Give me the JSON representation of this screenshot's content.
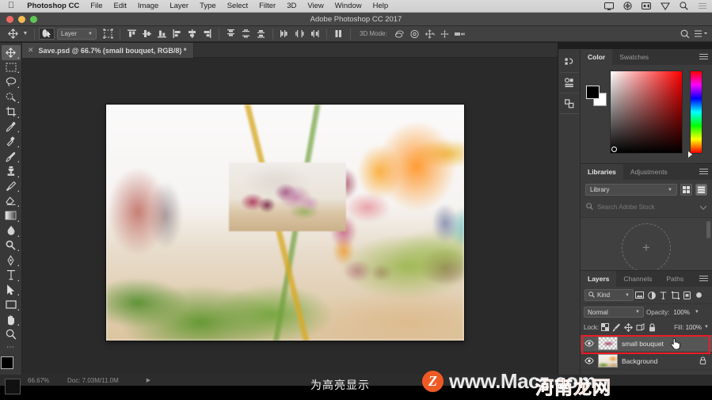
{
  "menubar": {
    "apple_icon": "apple-icon",
    "app_name": "Photoshop CC",
    "items": [
      "File",
      "Edit",
      "Image",
      "Layer",
      "Type",
      "Select",
      "Filter",
      "3D",
      "View",
      "Window",
      "Help"
    ],
    "status_icons": [
      "display-icon",
      "spotlight-wheel-icon",
      "screen-record-icon",
      "shield-icon",
      "search-icon",
      "control-center-icon"
    ]
  },
  "titlebar": {
    "title": "Adobe Photoshop CC 2017",
    "traffic_lights": [
      "close-red",
      "minimize-yellow",
      "zoom-green"
    ]
  },
  "options_bar": {
    "tool_icon": "move-tool-icon",
    "tool_caret": "chevron-down-icon",
    "auto_select_label": "Layer",
    "auto_select_icon": "auto-select-icon",
    "transform_controls_icon": "show-transform-controls-icon",
    "align_icons": [
      "align-top-edges-icon",
      "align-vertical-centers-icon",
      "align-bottom-edges-icon",
      "align-left-edges-icon",
      "align-horizontal-centers-icon",
      "align-right-edges-icon"
    ],
    "distribute_icons": [
      "distribute-top-edges-icon",
      "distribute-vertical-centers-icon",
      "distribute-bottom-edges-icon",
      "distribute-left-edges-icon",
      "distribute-horizontal-centers-icon",
      "distribute-right-edges-icon"
    ],
    "more_icon": "align-more-icon",
    "mode_3d_label": "3D Mode:",
    "mode_3d_icons": [
      "rotate-3d-icon",
      "roll-3d-icon",
      "drag-3d-icon",
      "slide-3d-icon",
      "scale-3d-icon"
    ],
    "search_icon": "search-icon",
    "workspace_icon": "workspace-switcher-icon"
  },
  "document_tab": {
    "close_icon": "close-icon",
    "title": "Save.psd @ 66.7% (small bouquet, RGB/8) *"
  },
  "toolbar": {
    "tools": [
      {
        "name": "move-tool",
        "icon": "move-tool-icon",
        "selected": true,
        "has_flyout": true
      },
      {
        "name": "rectangular-marquee-tool",
        "icon": "marquee-icon",
        "selected": false,
        "has_flyout": true
      },
      {
        "name": "lasso-tool",
        "icon": "lasso-icon",
        "selected": false,
        "has_flyout": true
      },
      {
        "name": "quick-selection-tool",
        "icon": "quick-selection-icon",
        "selected": false,
        "has_flyout": true
      },
      {
        "name": "crop-tool",
        "icon": "crop-icon",
        "selected": false,
        "has_flyout": true
      },
      {
        "name": "eyedropper-tool",
        "icon": "eyedropper-icon",
        "selected": false,
        "has_flyout": true
      },
      {
        "name": "spot-healing-brush-tool",
        "icon": "healing-brush-icon",
        "selected": false,
        "has_flyout": true
      },
      {
        "name": "brush-tool",
        "icon": "brush-icon",
        "selected": false,
        "has_flyout": true
      },
      {
        "name": "clone-stamp-tool",
        "icon": "clone-stamp-icon",
        "selected": false,
        "has_flyout": true
      },
      {
        "name": "history-brush-tool",
        "icon": "history-brush-icon",
        "selected": false,
        "has_flyout": true
      },
      {
        "name": "eraser-tool",
        "icon": "eraser-icon",
        "selected": false,
        "has_flyout": true
      },
      {
        "name": "gradient-tool",
        "icon": "gradient-icon",
        "selected": false,
        "has_flyout": true
      },
      {
        "name": "blur-tool",
        "icon": "blur-drop-icon",
        "selected": false,
        "has_flyout": true
      },
      {
        "name": "dodge-tool",
        "icon": "dodge-icon",
        "selected": false,
        "has_flyout": true
      },
      {
        "name": "pen-tool",
        "icon": "pen-icon",
        "selected": false,
        "has_flyout": true
      },
      {
        "name": "horizontal-type-tool",
        "icon": "type-icon",
        "selected": false,
        "has_flyout": true
      },
      {
        "name": "path-selection-tool",
        "icon": "path-selection-arrow-icon",
        "selected": false,
        "has_flyout": true
      },
      {
        "name": "rectangle-tool",
        "icon": "rectangle-shape-icon",
        "selected": false,
        "has_flyout": true
      },
      {
        "name": "hand-tool",
        "icon": "hand-icon",
        "selected": false,
        "has_flyout": true
      },
      {
        "name": "zoom-tool",
        "icon": "magnifier-icon",
        "selected": false,
        "has_flyout": false
      }
    ],
    "edit_toolbar_icon": "more-tools-icon",
    "foreground_color": "#000000",
    "background_color": "#ffffff"
  },
  "dock_strip": {
    "buttons": [
      "history-panel-icon",
      "properties-panel-icon",
      "layer-comps-panel-icon"
    ]
  },
  "color_panel": {
    "tabs": [
      {
        "label": "Color",
        "active": true
      },
      {
        "label": "Swatches",
        "active": false
      }
    ],
    "menu_icon": "panel-menu-icon",
    "foreground_color": "#000000",
    "background_color": "#ffffff",
    "spectrum_type": "hue-saturation-field",
    "hue_slider": "hue-strip"
  },
  "libraries_panel": {
    "tabs": [
      {
        "label": "Libraries",
        "active": true
      },
      {
        "label": "Adjustments",
        "active": false
      }
    ],
    "menu_icon": "panel-menu-icon",
    "library_select": "Library",
    "view_icons": [
      "grid-view-icon",
      "list-view-icon"
    ],
    "search_icon": "search-icon",
    "search_placeholder": "Search Adobe Stock",
    "search_caret": "chevron-down-icon",
    "empty_drop_icon": "plus-icon",
    "footer_icons": [
      "add-item-icon",
      "upload-icon",
      "sync-icon",
      "delete-icon"
    ]
  },
  "layers_panel": {
    "tabs": [
      {
        "label": "Layers",
        "active": true
      },
      {
        "label": "Channels",
        "active": false
      },
      {
        "label": "Paths",
        "active": false
      }
    ],
    "menu_icon": "panel-menu-icon",
    "filter_kind_label": "Kind",
    "filter_search_icon": "search-icon",
    "filter_icons": [
      "filter-pixel-icon",
      "filter-adjustment-icon",
      "filter-type-icon",
      "filter-shape-icon",
      "filter-smart-object-icon",
      "filter-toggle-icon"
    ],
    "blend_mode": "Normal",
    "opacity_label": "Opacity:",
    "opacity_value": "100%",
    "lock_label": "Lock:",
    "lock_icons": [
      "lock-transparent-pixels-icon",
      "lock-image-pixels-icon",
      "lock-position-icon",
      "lock-artboard-nesting-icon",
      "lock-all-icon"
    ],
    "fill_label": "Fill:",
    "fill_value": "100%",
    "layers": [
      {
        "name": "small bouquet",
        "visible": true,
        "visibility_icon": "eye-icon",
        "selected": true,
        "highlighted": true,
        "thumbnail": "transparent-bouquet-thumbnail",
        "locked": false
      },
      {
        "name": "Background",
        "visible": true,
        "visibility_icon": "eye-icon",
        "selected": false,
        "highlighted": false,
        "thumbnail": "flower-photo-thumbnail",
        "locked": true,
        "lock_icon": "lock-icon"
      }
    ],
    "cursor_icon": "pointing-hand-cursor-icon",
    "highlight_color": "#ee1c25"
  },
  "status_bar": {
    "zoom": "66.67%",
    "doc_info": "Doc: 7.03M/11.0M",
    "expand_icon": "chevron-right-icon"
  },
  "overlay": {
    "caption": "为高亮显示",
    "watermark_badge": "Z",
    "watermark_text": "www.Macz.com",
    "watermark_cn": "河南龙网",
    "badge_color": "#ef5a24"
  },
  "canvas": {
    "document_name": "Save.psd",
    "zoom_level": "66.7%",
    "active_layer": "small bouquet",
    "color_mode": "RGB/8",
    "description": "Blurred flower shop photo with a pasted smaller bouquet layer on top"
  }
}
